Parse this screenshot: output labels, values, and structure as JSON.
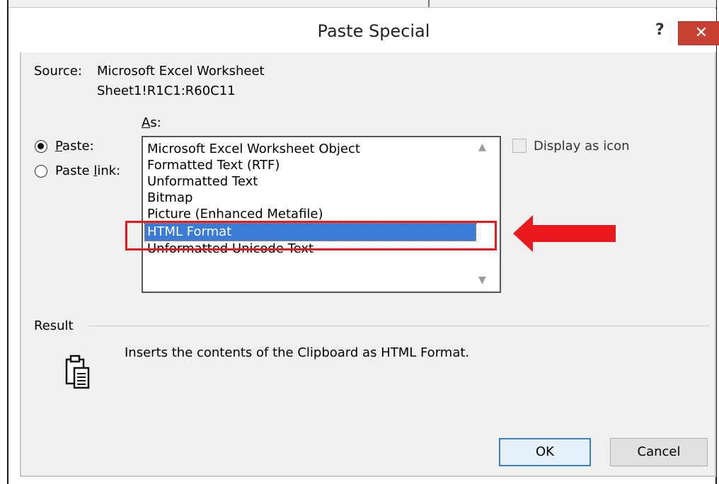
{
  "window": {
    "title": "Paste Special",
    "help_glyph": "?",
    "close_glyph": "✕"
  },
  "source": {
    "label": "Source:",
    "value": "Microsoft Excel Worksheet",
    "range": "Sheet1!R1C1:R60C11"
  },
  "as_label": {
    "first": "A",
    "rest": "s:"
  },
  "paste_mode": {
    "selected": "paste",
    "paste": {
      "first": "P",
      "rest": "aste:"
    },
    "paste_link": {
      "before": "Paste ",
      "mnemonic": "l",
      "after": "ink:"
    }
  },
  "formats": [
    "Microsoft Excel Worksheet Object",
    "Formatted Text (RTF)",
    "Unformatted Text",
    "Bitmap",
    "Picture (Enhanced Metafile)",
    "HTML Format",
    "Unformatted Unicode Text"
  ],
  "selected_format": "HTML Format",
  "display_as_icon": {
    "label": "Display as icon",
    "checked": false,
    "enabled": false
  },
  "result": {
    "label": "Result",
    "text": "Inserts the contents of the Clipboard as HTML Format."
  },
  "buttons": {
    "ok": "OK",
    "cancel": "Cancel"
  },
  "colors": {
    "selection": "#3a7bd5",
    "annotation": "#e8181c",
    "close_button": "#c84031",
    "dialog_body": "#f0f0f0"
  },
  "icons": {
    "scroll_up": "chevron-up-icon",
    "scroll_down": "chevron-down-icon",
    "result": "clipboard-icon",
    "annotation": "arrow-left-icon"
  }
}
